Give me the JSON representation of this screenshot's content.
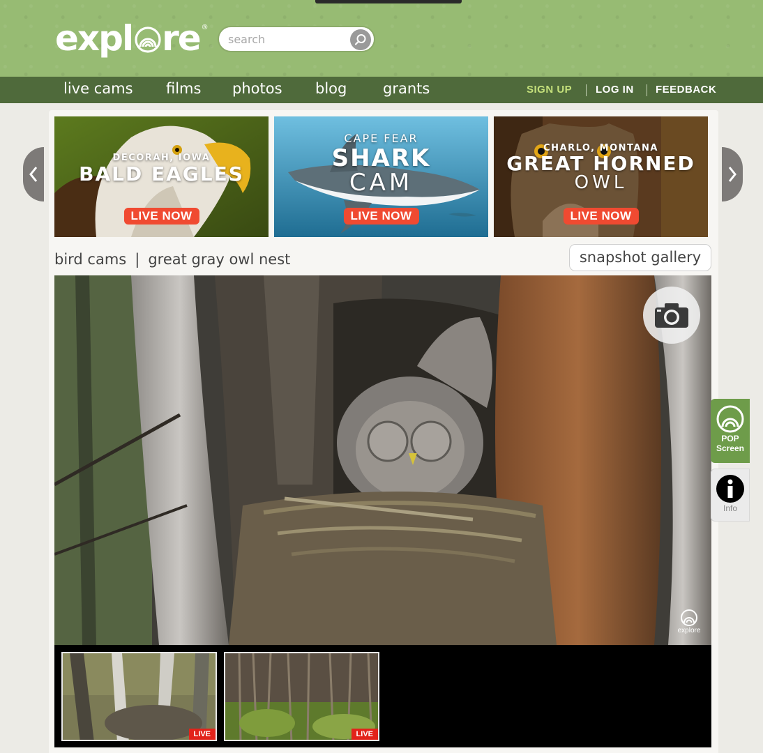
{
  "header": {
    "logo_text": "expl",
    "logo_text_end": "re",
    "logo_reg": "®",
    "search_placeholder": "search"
  },
  "nav": {
    "links": [
      "live cams",
      "films",
      "photos",
      "blog",
      "grants"
    ],
    "account": [
      "SIGN UP",
      "LOG IN",
      "FEEDBACK"
    ]
  },
  "banners": [
    {
      "small": "DECORAH, IOWA",
      "big": "BALD EAGLES",
      "big2": "",
      "cta": "LIVE NOW"
    },
    {
      "small": "CAPE FEAR",
      "big": "SHARK",
      "big2": "CAM",
      "cta": "LIVE NOW"
    },
    {
      "small": "CHARLO, MONTANA",
      "big": "GREAT HORNED",
      "big2": "OWL",
      "cta": "LIVE NOW"
    }
  ],
  "breadcrumb": {
    "category": "bird cams",
    "separator": "|",
    "page": "great gray owl nest"
  },
  "snapshot_gallery_label": "snapshot gallery",
  "player": {
    "watermark": "explore"
  },
  "thumbnails": [
    {
      "badge": "LIVE"
    },
    {
      "badge": "LIVE"
    }
  ],
  "side": {
    "pop_label_1": "POP",
    "pop_label_2": "Screen",
    "info_label": "Info"
  },
  "colors": {
    "header_green": "#97bb73",
    "nav_green": "#4f6a3b",
    "signup": "#c4e07b",
    "live_red": "#f04a31",
    "pop_green": "#6e9c4a"
  }
}
